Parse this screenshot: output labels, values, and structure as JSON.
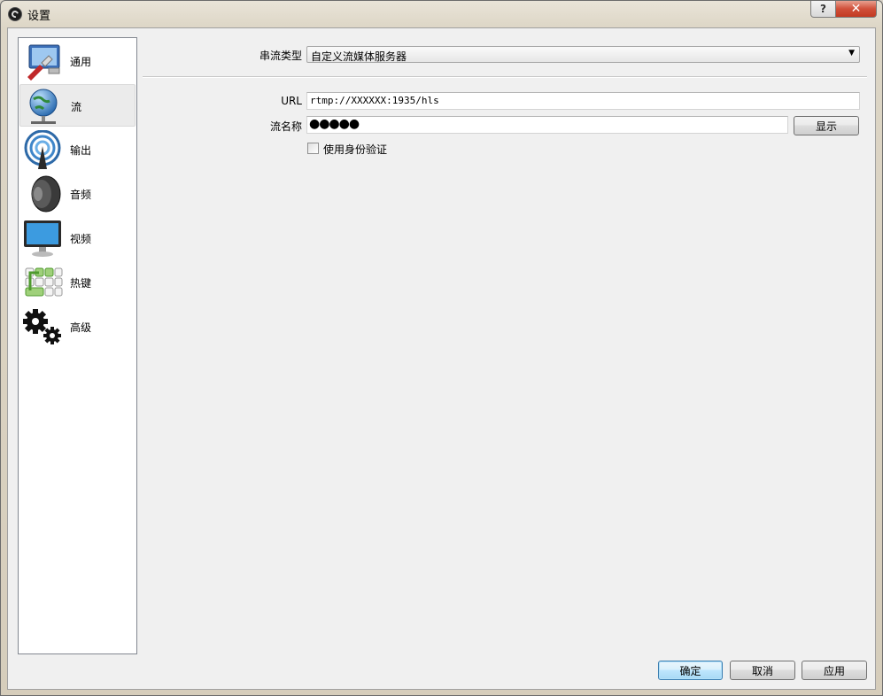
{
  "window": {
    "title": "设置",
    "help_label": "?",
    "close_label": "✕"
  },
  "sidebar": {
    "items": [
      {
        "label": "通用",
        "icon": "general-icon"
      },
      {
        "label": "流",
        "icon": "globe-network-icon",
        "selected": true
      },
      {
        "label": "输出",
        "icon": "broadcast-antenna-icon"
      },
      {
        "label": "音频",
        "icon": "speaker-icon"
      },
      {
        "label": "视频",
        "icon": "monitor-icon"
      },
      {
        "label": "热键",
        "icon": "keyboard-icon"
      },
      {
        "label": "高级",
        "icon": "gears-icon"
      }
    ]
  },
  "stream": {
    "type_label": "串流类型",
    "type_value": "自定义流媒体服务器",
    "url_label": "URL",
    "url_value": "rtmp://XXXXXX:1935/hls",
    "key_label": "流名称",
    "key_value": "●●●●●",
    "show_button": "显示",
    "auth_label": "使用身份验证",
    "auth_checked": false
  },
  "footer": {
    "ok": "确定",
    "cancel": "取消",
    "apply": "应用"
  },
  "colors": {
    "close_red": "#c23a22",
    "default_button_border": "#3c7fb1",
    "selection": "#ebebeb"
  }
}
